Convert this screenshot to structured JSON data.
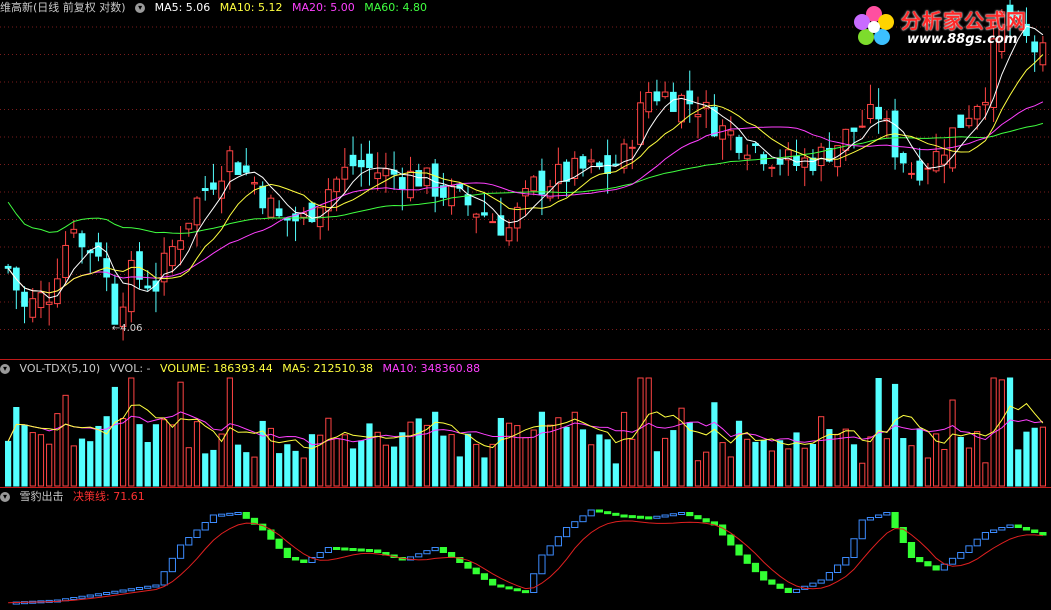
{
  "colors": {
    "up": "#ff4444",
    "down": "#54ffff",
    "ma5": "#ffffff",
    "ma10": "#ffff40",
    "ma20": "#ff40ff",
    "ma60": "#40ff40",
    "grid": "#7a1c1c",
    "divider": "#c01818"
  },
  "main": {
    "title": "维高新(日线 前复权 对数)",
    "indicators": [
      {
        "label": "MA5: 5.06",
        "color": "#ffffff"
      },
      {
        "label": "MA10: 5.12",
        "color": "#ffff40"
      },
      {
        "label": "MA20: 5.00",
        "color": "#ff40ff"
      },
      {
        "label": "MA60: 4.80",
        "color": "#40ff40"
      }
    ],
    "low_marker": "4.06"
  },
  "logo": {
    "name": "分析家公式网",
    "url": "www.88gs.com"
  },
  "volume": {
    "title": "VOL-TDX(5,10)",
    "vvol": "VVOL: -",
    "volume_label": "VOLUME: 186393.44",
    "ma5_label": "MA5: 212510.38",
    "ma10_label": "MA10: 348360.88"
  },
  "indicator": {
    "title": "雪豹出击",
    "line_label": "决策线: 71.61"
  },
  "chart_data": {
    "type": "candlestick",
    "scale": "log",
    "ylim": [
      3.9,
      5.75
    ],
    "low_price": 4.06,
    "count": 127,
    "anchors": [
      [
        0,
        4.3
      ],
      [
        2,
        4.1
      ],
      [
        5,
        4.18
      ],
      [
        8,
        4.55
      ],
      [
        9,
        4.4
      ],
      [
        11,
        4.4
      ],
      [
        13,
        4.08
      ],
      [
        15,
        4.27
      ],
      [
        18,
        4.22
      ],
      [
        20,
        4.4
      ],
      [
        23,
        4.65
      ],
      [
        27,
        4.9
      ],
      [
        30,
        4.75
      ],
      [
        33,
        4.55
      ],
      [
        36,
        4.55
      ],
      [
        39,
        4.72
      ],
      [
        42,
        4.85
      ],
      [
        46,
        4.8
      ],
      [
        50,
        4.78
      ],
      [
        53,
        4.7
      ],
      [
        56,
        4.63
      ],
      [
        58,
        4.58
      ],
      [
        61,
        4.5
      ],
      [
        64,
        4.73
      ],
      [
        67,
        4.78
      ],
      [
        70,
        4.82
      ],
      [
        73,
        4.82
      ],
      [
        75,
        4.9
      ],
      [
        78,
        5.28
      ],
      [
        81,
        5.25
      ],
      [
        84,
        5.2
      ],
      [
        87,
        5.05
      ],
      [
        90,
        4.98
      ],
      [
        93,
        4.9
      ],
      [
        96,
        4.85
      ],
      [
        99,
        4.9
      ],
      [
        103,
        5.05
      ],
      [
        106,
        5.15
      ],
      [
        108,
        4.95
      ],
      [
        110,
        4.82
      ],
      [
        113,
        4.9
      ],
      [
        116,
        5.1
      ],
      [
        119,
        5.3
      ],
      [
        121,
        5.75
      ],
      [
        123,
        5.65
      ],
      [
        126,
        5.5
      ]
    ],
    "indicator_anchors": [
      [
        0,
        2
      ],
      [
        6,
        4
      ],
      [
        12,
        10
      ],
      [
        18,
        16
      ],
      [
        21,
        48
      ],
      [
        25,
        72
      ],
      [
        28,
        74
      ],
      [
        31,
        60
      ],
      [
        34,
        38
      ],
      [
        36,
        34
      ],
      [
        39,
        46
      ],
      [
        44,
        44
      ],
      [
        48,
        36
      ],
      [
        52,
        46
      ],
      [
        55,
        34
      ],
      [
        59,
        16
      ],
      [
        63,
        10
      ],
      [
        65,
        40
      ],
      [
        68,
        62
      ],
      [
        71,
        76
      ],
      [
        74,
        72
      ],
      [
        78,
        70
      ],
      [
        82,
        74
      ],
      [
        86,
        64
      ],
      [
        89,
        40
      ],
      [
        92,
        20
      ],
      [
        95,
        10
      ],
      [
        99,
        20
      ],
      [
        102,
        38
      ],
      [
        104,
        68
      ],
      [
        107,
        74
      ],
      [
        110,
        38
      ],
      [
        113,
        28
      ],
      [
        116,
        42
      ],
      [
        119,
        58
      ],
      [
        122,
        64
      ],
      [
        126,
        56
      ]
    ]
  }
}
